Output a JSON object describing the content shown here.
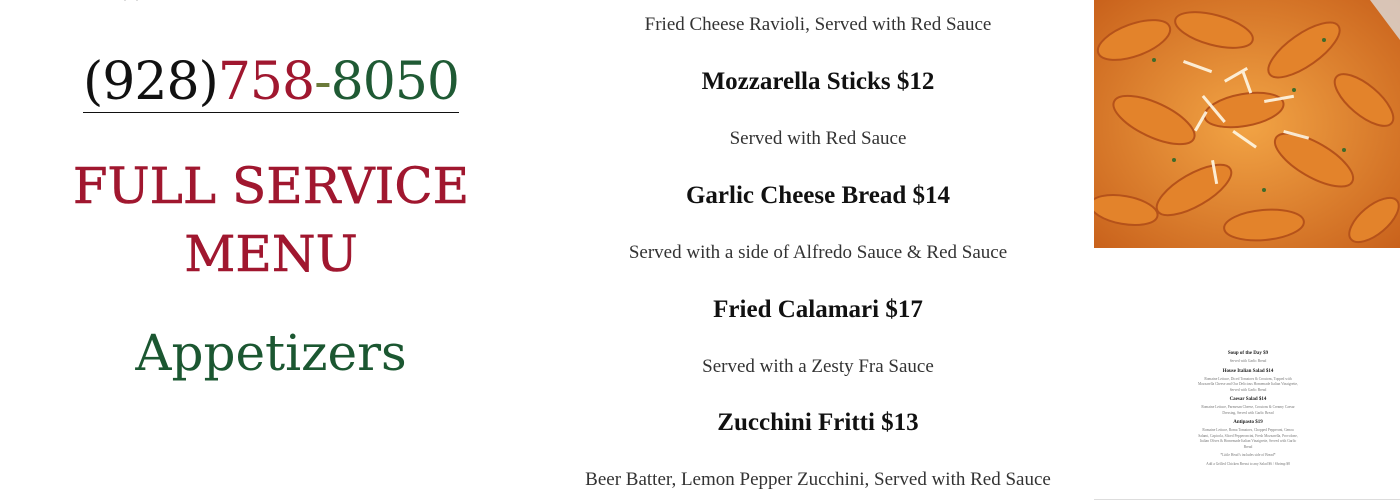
{
  "social": {
    "icons": [
      "yelp-icon",
      "facebook-icon",
      "instagram-icon",
      "pinterest-icon",
      "tripadvisor-bubble-icon",
      "tripadvisor-owl-icon"
    ]
  },
  "phone": {
    "area": "(928)",
    "prefix": "758",
    "dash": "-",
    "line": "8050"
  },
  "titles": {
    "menu_line1": "FULL SERVICE",
    "menu_line2": "MENU",
    "section": "Appetizers"
  },
  "menu": {
    "top_desc": "Fried Cheese Ravioli, Served with Red Sauce",
    "items": [
      {
        "name": "Mozzarella Sticks $12",
        "desc": "Served with Red Sauce"
      },
      {
        "name": "Garlic Cheese Bread $14",
        "desc": "Served with a side of Alfredo Sauce & Red Sauce"
      },
      {
        "name": "Fried Calamari $17",
        "desc": "Served with a Zesty Fra Sauce"
      },
      {
        "name": "Zucchini Fritti $13",
        "desc": "Beer Batter, Lemon Pepper Zucchini, Served with Red Sauce"
      }
    ]
  },
  "thumbnail": {
    "entries": [
      {
        "name": "Soup of the Day $9",
        "desc": "Served with Garlic Bread"
      },
      {
        "name": "House Italian Salad $14",
        "desc": "Romaine Lettuce, Diced Tomatoes & Croutons, Topped with Mozzarella Cheese and Our Delicious Homemade Italian Vinaigrette, Served with Garlic Bread"
      },
      {
        "name": "Caesar Salad $14",
        "desc": "Romaine Lettuce, Parmesan Cheese, Croutons & Creamy Caesar Dressing, Served with Garlic Bread"
      },
      {
        "name": "Antipasto $19",
        "desc": "Romaine Lettuce, Roma Tomatoes, Chopped Pepperoni, Genoa Salami, Capicola, Sliced Pepperoncini, Fresh Mozzarella, Provolone, Italian Olives & Homemade Italian Vinaigrette, Served with Garlic Bread"
      },
      {
        "name": "",
        "desc": "*Little Head’s includes side of Bread*"
      },
      {
        "name": "",
        "desc": "Add a Grilled Chicken Breast to any Salad $6 / Shrimp $8"
      }
    ]
  },
  "colors": {
    "crimson": "#a0172f",
    "green": "#1b5731",
    "text_dark": "#111111",
    "text_desc": "#333333"
  }
}
